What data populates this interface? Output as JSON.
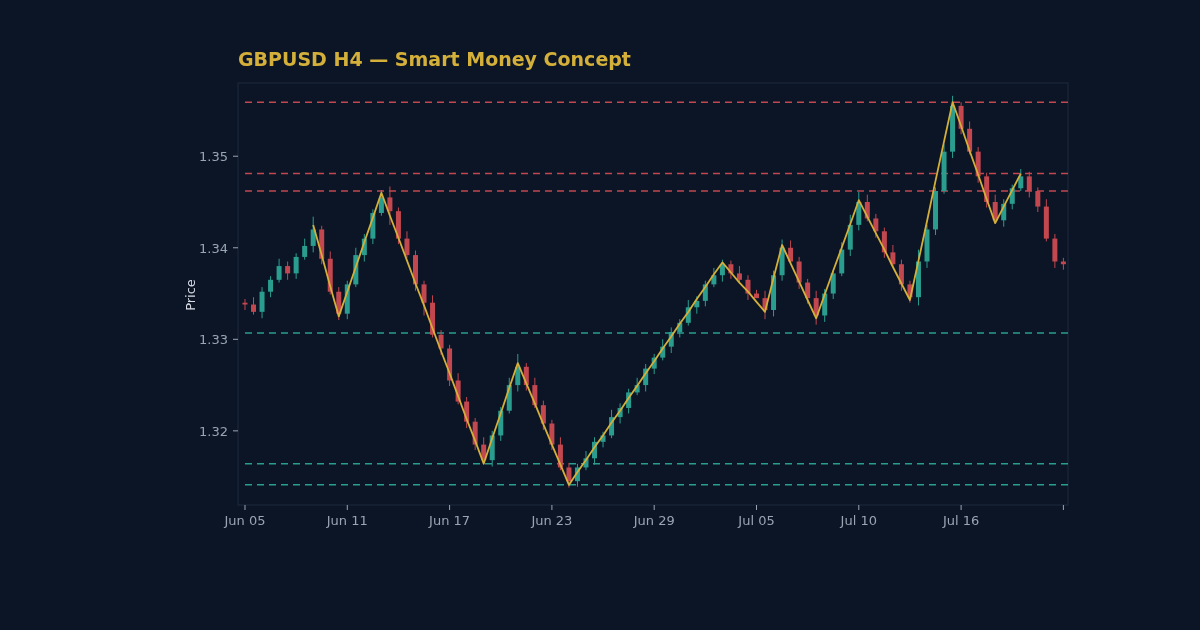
{
  "chart": {
    "chart_data": {
      "type": "candlestick",
      "title": "GBPUSD H4 — Smart Money Concept",
      "ylabel": "Price",
      "categories": [
        "Jun 05",
        null,
        null,
        null,
        null,
        null,
        null,
        null,
        null,
        null,
        null,
        null,
        "Jun 11",
        null,
        null,
        null,
        null,
        null,
        null,
        null,
        null,
        null,
        null,
        null,
        "Jun 17",
        null,
        null,
        null,
        null,
        null,
        null,
        null,
        null,
        null,
        null,
        null,
        "Jun 23",
        null,
        null,
        null,
        null,
        null,
        null,
        null,
        null,
        null,
        null,
        null,
        "Jun 29",
        null,
        null,
        null,
        null,
        null,
        null,
        null,
        null,
        null,
        null,
        null,
        "Jul 05",
        null,
        null,
        null,
        null,
        null,
        null,
        null,
        null,
        null,
        null,
        null,
        "Jul 10",
        null,
        null,
        null,
        null,
        null,
        null,
        null,
        null,
        null,
        null,
        null,
        "Jul 16",
        null,
        null,
        null,
        null,
        null,
        null,
        null,
        null,
        null,
        null,
        null,
        null
      ],
      "ohlc": [
        [
          1.334,
          1.3344,
          1.3332,
          1.3338
        ],
        [
          1.3338,
          1.3346,
          1.3327,
          1.333
        ],
        [
          1.333,
          1.3357,
          1.3323,
          1.3352
        ],
        [
          1.3352,
          1.3369,
          1.3346,
          1.3365
        ],
        [
          1.3365,
          1.3388,
          1.3362,
          1.338
        ],
        [
          1.338,
          1.3385,
          1.3365,
          1.3372
        ],
        [
          1.3372,
          1.3394,
          1.3366,
          1.339
        ],
        [
          1.339,
          1.341,
          1.3387,
          1.3402
        ],
        [
          1.3402,
          1.3434,
          1.3395,
          1.342
        ],
        [
          1.342,
          1.3424,
          1.3382,
          1.3388
        ],
        [
          1.3388,
          1.3396,
          1.3349,
          1.3352
        ],
        [
          1.3352,
          1.3357,
          1.3321,
          1.3328
        ],
        [
          1.3328,
          1.3364,
          1.3322,
          1.336
        ],
        [
          1.336,
          1.34,
          1.3357,
          1.3392
        ],
        [
          1.3392,
          1.3415,
          1.3385,
          1.341
        ],
        [
          1.341,
          1.3442,
          1.3404,
          1.3438
        ],
        [
          1.3438,
          1.3463,
          1.3435,
          1.3455
        ],
        [
          1.3455,
          1.3467,
          1.3425,
          1.344
        ],
        [
          1.344,
          1.3444,
          1.3404,
          1.341
        ],
        [
          1.341,
          1.3418,
          1.3389,
          1.3392
        ],
        [
          1.3392,
          1.3397,
          1.3353,
          1.336
        ],
        [
          1.336,
          1.3364,
          1.3326,
          1.334
        ],
        [
          1.334,
          1.3348,
          1.3302,
          1.3305
        ],
        [
          1.3305,
          1.331,
          1.3283,
          1.329
        ],
        [
          1.329,
          1.3294,
          1.3249,
          1.3255
        ],
        [
          1.3255,
          1.3263,
          1.3229,
          1.3232
        ],
        [
          1.3232,
          1.3237,
          1.3203,
          1.321
        ],
        [
          1.321,
          1.3214,
          1.3179,
          1.3185
        ],
        [
          1.3185,
          1.3193,
          1.3165,
          1.3168
        ],
        [
          1.3168,
          1.32,
          1.3161,
          1.3195
        ],
        [
          1.3195,
          1.3226,
          1.3189,
          1.3222
        ],
        [
          1.3222,
          1.3258,
          1.3219,
          1.325
        ],
        [
          1.325,
          1.3284,
          1.3243,
          1.327
        ],
        [
          1.327,
          1.3274,
          1.3244,
          1.325
        ],
        [
          1.325,
          1.3258,
          1.3225,
          1.3228
        ],
        [
          1.3228,
          1.3233,
          1.3201,
          1.3208
        ],
        [
          1.3208,
          1.3212,
          1.3179,
          1.3185
        ],
        [
          1.3185,
          1.3193,
          1.3157,
          1.316
        ],
        [
          1.316,
          1.3165,
          1.3138,
          1.3145
        ],
        [
          1.3145,
          1.3164,
          1.3139,
          1.316
        ],
        [
          1.316,
          1.3178,
          1.3157,
          1.317
        ],
        [
          1.317,
          1.3193,
          1.3163,
          1.3188
        ],
        [
          1.3188,
          1.3199,
          1.3182,
          1.3195
        ],
        [
          1.3195,
          1.3223,
          1.3192,
          1.3215
        ],
        [
          1.3215,
          1.323,
          1.3208,
          1.3225
        ],
        [
          1.3225,
          1.3246,
          1.3219,
          1.3242
        ],
        [
          1.3242,
          1.3258,
          1.3239,
          1.325
        ],
        [
          1.325,
          1.3273,
          1.3243,
          1.3268
        ],
        [
          1.3268,
          1.3284,
          1.3262,
          1.328
        ],
        [
          1.328,
          1.33,
          1.3277,
          1.3292
        ],
        [
          1.3292,
          1.3313,
          1.3285,
          1.3308
        ],
        [
          1.3308,
          1.3322,
          1.3302,
          1.3318
        ],
        [
          1.3318,
          1.3343,
          1.3315,
          1.3335
        ],
        [
          1.3335,
          1.3347,
          1.3328,
          1.3342
        ],
        [
          1.3342,
          1.3364,
          1.3336,
          1.336
        ],
        [
          1.336,
          1.3378,
          1.3357,
          1.337
        ],
        [
          1.337,
          1.3387,
          1.3363,
          1.3382
        ],
        [
          1.3382,
          1.3386,
          1.3366,
          1.3372
        ],
        [
          1.3372,
          1.338,
          1.3362,
          1.3365
        ],
        [
          1.3365,
          1.337,
          1.3343,
          1.335
        ],
        [
          1.335,
          1.3354,
          1.3345,
          1.3345
        ],
        [
          1.3345,
          1.3353,
          1.3322,
          1.3332
        ],
        [
          1.3332,
          1.3375,
          1.3325,
          1.337
        ],
        [
          1.337,
          1.3409,
          1.3364,
          1.34
        ],
        [
          1.34,
          1.3408,
          1.3382,
          1.3385
        ],
        [
          1.3385,
          1.339,
          1.3355,
          1.3362
        ],
        [
          1.3362,
          1.3366,
          1.3339,
          1.3345
        ],
        [
          1.3345,
          1.3353,
          1.3316,
          1.3326
        ],
        [
          1.3326,
          1.3355,
          1.3319,
          1.335
        ],
        [
          1.335,
          1.3376,
          1.3344,
          1.3372
        ],
        [
          1.3372,
          1.3406,
          1.3369,
          1.3398
        ],
        [
          1.3398,
          1.3436,
          1.3391,
          1.3425
        ],
        [
          1.3425,
          1.3461,
          1.3419,
          1.345
        ],
        [
          1.345,
          1.3458,
          1.3429,
          1.3432
        ],
        [
          1.3432,
          1.3437,
          1.3411,
          1.3418
        ],
        [
          1.3418,
          1.3422,
          1.3389,
          1.3395
        ],
        [
          1.3395,
          1.3403,
          1.3379,
          1.3382
        ],
        [
          1.3382,
          1.3387,
          1.3353,
          1.336
        ],
        [
          1.336,
          1.3364,
          1.334,
          1.3346
        ],
        [
          1.3346,
          1.3398,
          1.3337,
          1.3385
        ],
        [
          1.3385,
          1.3425,
          1.3378,
          1.342
        ],
        [
          1.342,
          1.3466,
          1.3414,
          1.3462
        ],
        [
          1.3462,
          1.3513,
          1.3459,
          1.3505
        ],
        [
          1.3505,
          1.3566,
          1.3498,
          1.3555
        ],
        [
          1.3555,
          1.3559,
          1.3524,
          1.353
        ],
        [
          1.353,
          1.3538,
          1.3502,
          1.3505
        ],
        [
          1.3505,
          1.351,
          1.3471,
          1.3478
        ],
        [
          1.3478,
          1.3482,
          1.3444,
          1.345
        ],
        [
          1.345,
          1.3458,
          1.3427,
          1.343
        ],
        [
          1.343,
          1.3453,
          1.3423,
          1.3448
        ],
        [
          1.3448,
          1.3469,
          1.3442,
          1.3465
        ],
        [
          1.3465,
          1.3486,
          1.3462,
          1.3478
        ],
        [
          1.3478,
          1.3483,
          1.3455,
          1.3462
        ],
        [
          1.3462,
          1.3466,
          1.3439,
          1.3445
        ],
        [
          1.3445,
          1.3453,
          1.3407,
          1.341
        ],
        [
          1.341,
          1.3415,
          1.3378,
          1.3385
        ],
        [
          1.3385,
          1.3389,
          1.3376,
          1.3382
        ]
      ],
      "series": [
        {
          "type": "line",
          "color": "#d4b03a",
          "values": [
            null,
            null,
            null,
            null,
            null,
            null,
            null,
            null,
            1.3425,
            1.3392,
            1.3358,
            1.3325,
            1.3352,
            1.3379,
            1.3406,
            1.3433,
            1.346,
            1.3435,
            1.3411,
            1.3386,
            1.3361,
            1.3337,
            1.3312,
            1.3287,
            1.3263,
            1.3238,
            1.3213,
            1.3189,
            1.3164,
            1.3192,
            1.3219,
            1.3247,
            1.3274,
            1.3252,
            1.323,
            1.3207,
            1.3185,
            1.3163,
            1.3141,
            1.3155,
            1.3168,
            1.3182,
            1.3195,
            1.3209,
            1.3222,
            1.3236,
            1.3249,
            1.3263,
            1.3276,
            1.329,
            1.3303,
            1.3317,
            1.333,
            1.3344,
            1.3357,
            1.3371,
            1.3384,
            1.3373,
            1.3362,
            1.3352,
            1.3341,
            1.333,
            1.3367,
            1.3403,
            1.3383,
            1.3363,
            1.3343,
            1.3323,
            1.3349,
            1.3375,
            1.34,
            1.3426,
            1.3452,
            1.3434,
            1.3416,
            1.3398,
            1.3379,
            1.3361,
            1.3343,
            1.3386,
            1.3429,
            1.3473,
            1.3516,
            1.3559,
            1.3533,
            1.3506,
            1.348,
            1.3453,
            1.3427,
            1.3445,
            1.3463,
            1.3481,
            null,
            null,
            null,
            null,
            null
          ]
        }
      ],
      "ylim": [
        1.3119,
        1.358
      ],
      "yticks": [
        1.32,
        1.33,
        1.34,
        1.35
      ],
      "ref_lines": [
        {
          "axis": "y",
          "value": 1.3559,
          "color": "#c2474f"
        },
        {
          "axis": "y",
          "value": 1.3481,
          "color": "#c2474f"
        },
        {
          "axis": "y",
          "value": 1.3462,
          "color": "#c2474f"
        },
        {
          "axis": "y",
          "value": 1.3307,
          "color": "#2a9d8f"
        },
        {
          "axis": "y",
          "value": 1.3164,
          "color": "#2a9d8f"
        },
        {
          "axis": "y",
          "value": 1.3141,
          "color": "#2a9d8f"
        }
      ]
    }
  }
}
